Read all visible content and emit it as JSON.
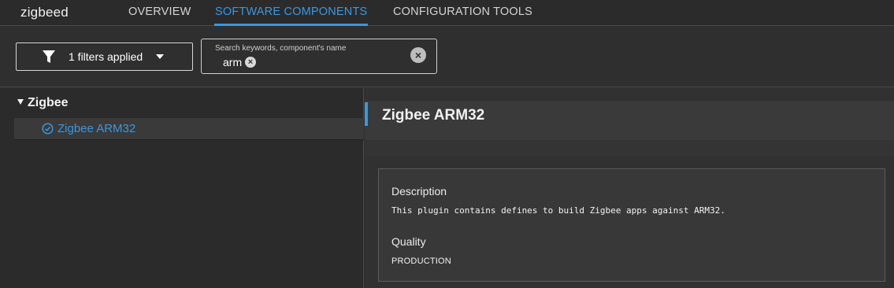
{
  "app": {
    "title": "zigbeed"
  },
  "tabs": [
    {
      "label": "OVERVIEW"
    },
    {
      "label": "SOFTWARE COMPONENTS"
    },
    {
      "label": "CONFIGURATION TOOLS"
    }
  ],
  "active_tab": "SOFTWARE COMPONENTS",
  "accent_color": "#3a97e0",
  "filter": {
    "label": "1 filters applied",
    "icon": "funnel-icon"
  },
  "search": {
    "placeholder": "Search keywords, component's name",
    "chip": "arm",
    "clear_icon": "clear-circle-icon"
  },
  "tree": {
    "group": "Zigbee",
    "items": [
      {
        "label": "Zigbee ARM32",
        "icon": "check-circle-icon"
      }
    ]
  },
  "detail": {
    "title": "Zigbee ARM32",
    "description_label": "Description",
    "description": "This plugin contains defines to build Zigbee apps against ARM32.",
    "quality_label": "Quality",
    "quality": "PRODUCTION"
  }
}
